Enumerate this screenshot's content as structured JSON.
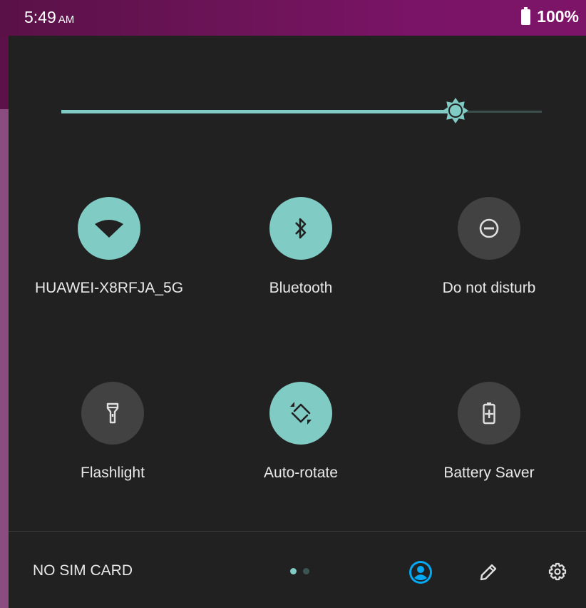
{
  "status_bar": {
    "time": "5:49",
    "ampm": "AM",
    "battery_percent": "100%"
  },
  "brightness": {
    "level": 0.82
  },
  "tiles": [
    {
      "label": "HUAWEI-X8RFJA_5G",
      "icon": "wifi-icon",
      "active": true
    },
    {
      "label": "Bluetooth",
      "icon": "bluetooth-icon",
      "active": true
    },
    {
      "label": "Do not disturb",
      "icon": "do-not-disturb-icon",
      "active": false
    },
    {
      "label": "Flashlight",
      "icon": "flashlight-icon",
      "active": false
    },
    {
      "label": "Auto-rotate",
      "icon": "auto-rotate-icon",
      "active": true
    },
    {
      "label": "Battery Saver",
      "icon": "battery-saver-icon",
      "active": false
    }
  ],
  "footer": {
    "carrier_text": "NO SIM CARD",
    "page_dots": {
      "count": 2,
      "active": 0
    },
    "icons": [
      "user-account-icon",
      "edit-pencil-icon",
      "settings-gear-icon"
    ]
  },
  "colors": {
    "accent": "#80cbc4",
    "panel_bg": "#212121",
    "tile_off": "#424242",
    "status_bar": "#7a1466",
    "user_icon": "#03a9f4"
  }
}
